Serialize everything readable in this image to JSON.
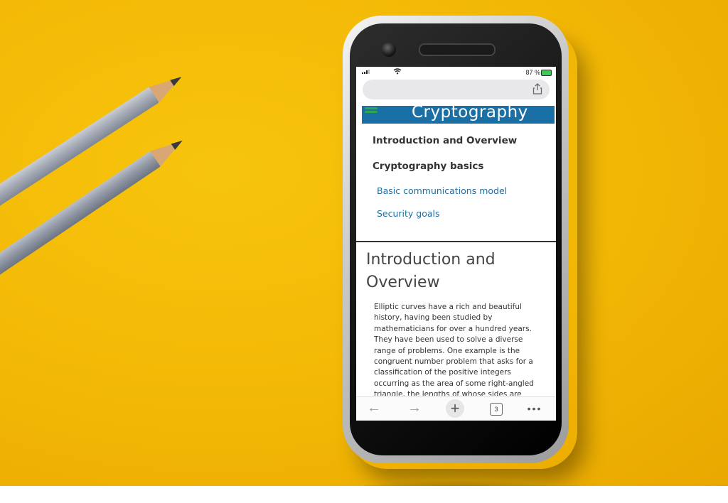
{
  "status_bar": {
    "battery_text": "87 %",
    "wifi_icon": "wifi-icon",
    "signal_icon": "signal-icon"
  },
  "browser": {
    "url_value": "",
    "share_icon": "share-icon"
  },
  "site": {
    "title": "Cryptography",
    "menu_icon": "hamburger-menu-icon",
    "header_color": "#1a6fa5"
  },
  "toc": {
    "items": [
      {
        "label": "Introduction and Overview",
        "type": "heading"
      },
      {
        "label": "Cryptography basics",
        "type": "heading"
      },
      {
        "label": "Basic communications model",
        "type": "link"
      },
      {
        "label": "Security goals",
        "type": "link"
      }
    ]
  },
  "article": {
    "title": "Introduction and Overview",
    "body": "Elliptic curves have a rich and beautiful history, having been studied by mathematicians for over a hundred years. They have been used to solve a diverse range of problems. One example is the congruent number problem that asks for a classification of the positive integers occurring as the area of some right-angled triangle, the lengths of whose sides are rational numbers. Another"
  },
  "toolbar": {
    "back_icon": "←",
    "forward_icon": "→",
    "new_tab_icon": "+",
    "tab_count": "3",
    "more_icon": "•••"
  },
  "colors": {
    "background": "#f2b705",
    "link": "#1f6fa0",
    "menu_icon": "#2ca74b"
  }
}
